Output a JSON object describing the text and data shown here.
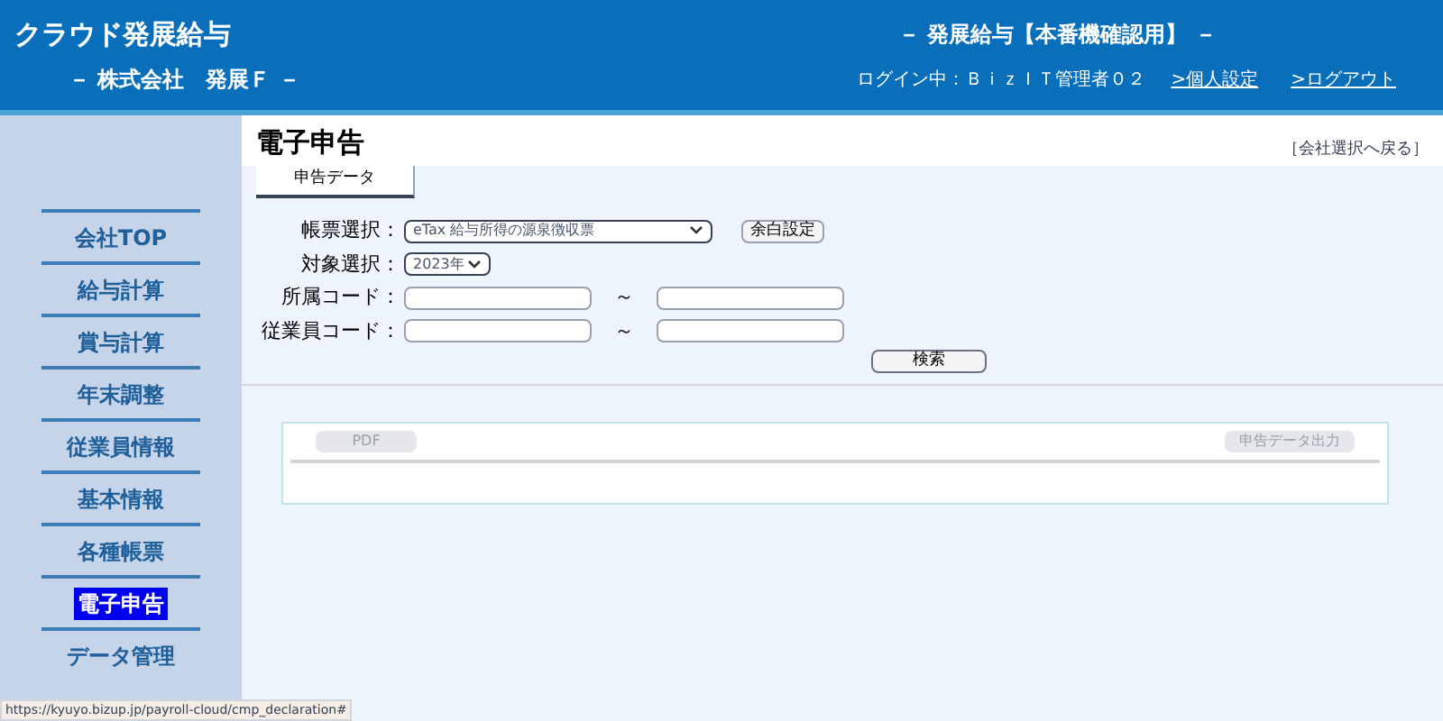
{
  "header": {
    "logo": "クラウド発展給与",
    "company": "－ 株式会社　発展Ｆ －",
    "system": "－ 発展給与【本番機確認用】 －",
    "login": "ログイン中：ＢｉｚＩＴ管理者０２",
    "links": [
      ">個人設定",
      ">ログアウト"
    ]
  },
  "sidebar": {
    "items": [
      {
        "label": "会社TOP",
        "selected": false
      },
      {
        "label": "給与計算",
        "selected": false
      },
      {
        "label": "賞与計算",
        "selected": false
      },
      {
        "label": "年末調整",
        "selected": false
      },
      {
        "label": "従業員情報",
        "selected": false
      },
      {
        "label": "基本情報",
        "selected": false
      },
      {
        "label": "各種帳票",
        "selected": false
      },
      {
        "label": "電子申告",
        "selected": true
      },
      {
        "label": "データ管理",
        "selected": false
      }
    ]
  },
  "page": {
    "title": "電子申告",
    "back_link": "［会社選択へ戻る］",
    "tabs": [
      {
        "label": "申告データ",
        "selected": true
      }
    ]
  },
  "form": {
    "report_label": "帳票選択：",
    "report_value": "eTax 給与所得の源泉徴収票",
    "margin_button": "余白設定",
    "target_label": "対象選択：",
    "target_value": "2023年",
    "dept_label": "所属コード：",
    "employee_label": "従業員コード：",
    "range_sep": "～",
    "search_button": "検索"
  },
  "results": {
    "buttons": [
      {
        "label": "PDF",
        "disabled": true
      },
      {
        "label": "申告データ出力",
        "disabled": true
      }
    ]
  },
  "status_bar": {
    "url": "https://kyuyo.bizup.jp/payroll-cloud/cmp_declaration#"
  }
}
